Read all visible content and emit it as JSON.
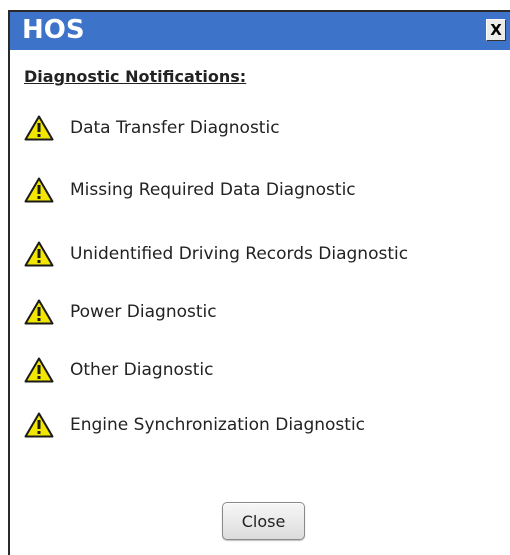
{
  "window": {
    "title": "HOS",
    "close_glyph": "X"
  },
  "section": {
    "heading": "Diagnostic Notifications:"
  },
  "diagnostics": [
    {
      "label": "Data Transfer Diagnostic",
      "icon": "warning-icon"
    },
    {
      "label": "Missing Required Data Diagnostic",
      "icon": "warning-icon"
    },
    {
      "label": "Unidentified Driving Records Diagnostic",
      "icon": "warning-icon"
    },
    {
      "label": "Power Diagnostic",
      "icon": "warning-icon"
    },
    {
      "label": "Other Diagnostic",
      "icon": "warning-icon"
    },
    {
      "label": "Engine Synchronization Diagnostic",
      "icon": "warning-icon"
    }
  ],
  "footer": {
    "close_label": "Close"
  },
  "colors": {
    "title_bar": "#3d73c9",
    "warning_fill": "#f2e600",
    "warning_stroke": "#1a1a1a"
  }
}
